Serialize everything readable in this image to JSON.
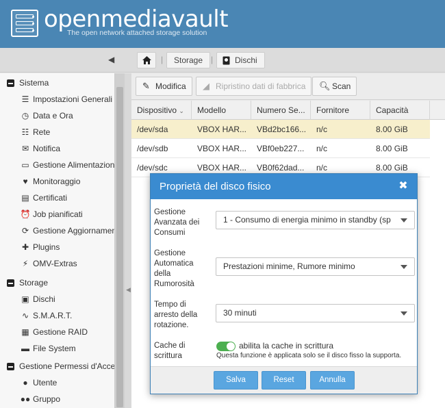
{
  "header": {
    "logo_text": "openmediavault",
    "tagline": "The open network attached storage solution"
  },
  "breadcrumb": {
    "home_icon": "home-icon",
    "items": [
      {
        "label": "Storage"
      },
      {
        "label": "Dischi",
        "icon": "disk-icon"
      }
    ]
  },
  "sidebar": {
    "groups": [
      {
        "label": "Sistema",
        "items": [
          {
            "label": "Impostazioni Generali",
            "icon": "sliders-icon"
          },
          {
            "label": "Data e Ora",
            "icon": "clock-icon"
          },
          {
            "label": "Rete",
            "icon": "network-icon"
          },
          {
            "label": "Notifica",
            "icon": "mail-icon"
          },
          {
            "label": "Gestione Alimentazione",
            "icon": "battery-icon"
          },
          {
            "label": "Monitoraggio",
            "icon": "heartbeat-icon"
          },
          {
            "label": "Certificati",
            "icon": "certificate-icon"
          },
          {
            "label": "Job pianificati",
            "icon": "alarm-icon"
          },
          {
            "label": "Gestione Aggiornamenti",
            "icon": "refresh-icon"
          },
          {
            "label": "Plugins",
            "icon": "puzzle-icon"
          },
          {
            "label": "OMV-Extras",
            "icon": "plug-icon"
          }
        ]
      },
      {
        "label": "Storage",
        "items": [
          {
            "label": "Dischi",
            "icon": "disk-icon"
          },
          {
            "label": "S.M.A.R.T.",
            "icon": "pulse-icon"
          },
          {
            "label": "Gestione RAID",
            "icon": "raid-icon"
          },
          {
            "label": "File System",
            "icon": "folder-icon"
          }
        ]
      },
      {
        "label": "Gestione Permessi d'Accesso",
        "items": [
          {
            "label": "Utente",
            "icon": "user-icon"
          },
          {
            "label": "Gruppo",
            "icon": "group-icon"
          }
        ]
      }
    ]
  },
  "toolbar": {
    "edit": "Modifica",
    "wipe": "Ripristino dati di fabbrica",
    "scan": "Scan"
  },
  "grid": {
    "columns": [
      "Dispositivo",
      "Modello",
      "Numero Se...",
      "Fornitore",
      "Capacità"
    ],
    "rows": [
      [
        "/dev/sda",
        "VBOX HAR...",
        "VBd2bc166...",
        "n/c",
        "8.00 GiB"
      ],
      [
        "/dev/sdb",
        "VBOX HAR...",
        "VBf0eb227...",
        "n/c",
        "8.00 GiB"
      ],
      [
        "/dev/sdc",
        "VBOX HAR...",
        "VB0f62dad...",
        "n/c",
        "8.00 GiB"
      ]
    ],
    "selected_row": 0
  },
  "dialog": {
    "title": "Proprietà del disco fisico",
    "fields": [
      {
        "label": "Gestione Avanzata dei Consumi",
        "value": "1 - Consumo di energia minimo in standby (sp"
      },
      {
        "label": "Gestione Automatica della Rumorosità",
        "value": "Prestazioni minime, Rumore minimo"
      },
      {
        "label": "Tempo di arresto della rotazione.",
        "value": "30 minuti"
      }
    ],
    "cache": {
      "label": "Cache di scrittura",
      "toggle_label": "abilita la cache in scrittura",
      "enabled": true,
      "hint": "Questa funzione è applicata solo se il disco fisso la supporta."
    },
    "buttons": {
      "save": "Salva",
      "reset": "Reset",
      "cancel": "Annulla"
    }
  },
  "colors": {
    "header": "#4a86b4",
    "dialog_title": "#3a8bd0",
    "button": "#5aa6e0",
    "selected_row": "#f7efcc",
    "toggle_on": "#4caf50"
  }
}
